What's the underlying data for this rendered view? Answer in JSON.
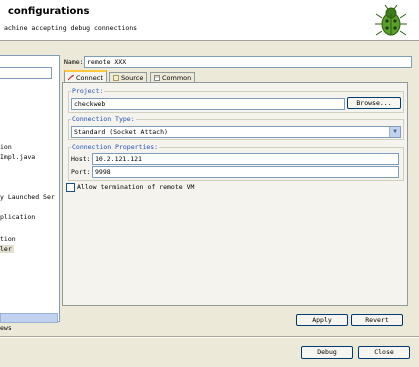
{
  "header": {
    "title": "configurations",
    "subtitle": "achine accepting debug connections",
    "icon": "bug-icon"
  },
  "left_tree": {
    "items": [
      {
        "label": "ion"
      },
      {
        "label": "Impl.java"
      },
      {
        "label": "y Launched Ser"
      },
      {
        "label": "plication"
      },
      {
        "label": "tion"
      },
      {
        "label": "ler"
      }
    ],
    "bottom_text": "ews"
  },
  "name": {
    "label": "Name:",
    "value": "remote XXX"
  },
  "tabs": [
    {
      "label": "Connect",
      "icon": "connect-icon"
    },
    {
      "label": "Source",
      "icon": "source-icon"
    },
    {
      "label": "Common",
      "icon": "common-icon"
    }
  ],
  "project": {
    "label": "Project:",
    "value": "checkweb",
    "browse_label": "Browse..."
  },
  "connection_type": {
    "label": "Connection Type:",
    "value": "Standard (Socket Attach)"
  },
  "connection_properties": {
    "label": "Connection Properties:",
    "host_label": "Host:",
    "host_value": "10.2.121.121",
    "port_label": "Port:",
    "port_value": "9998"
  },
  "allow_termination": {
    "label": "Allow termination of remote VM",
    "checked": false
  },
  "buttons": {
    "apply": "Apply",
    "revert": "Revert",
    "debug": "Debug",
    "close": "Close"
  }
}
